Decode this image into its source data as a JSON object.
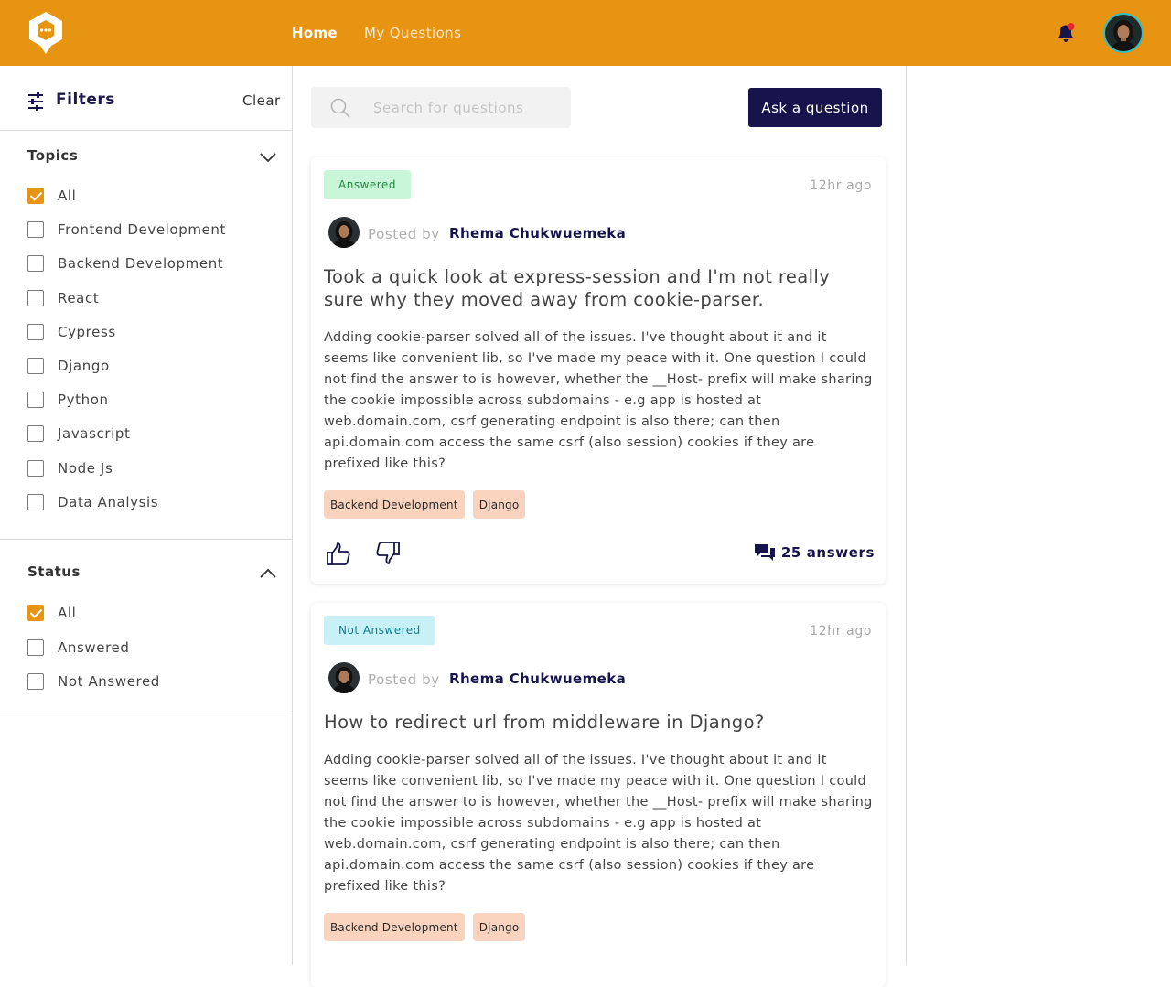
{
  "header": {
    "nav": {
      "home": "Home",
      "my_questions": "My Questions"
    },
    "accent": "#e89413"
  },
  "sidebar": {
    "filters_title": "Filters",
    "clear_label": "Clear",
    "topics": {
      "title": "Topics",
      "expanded": true,
      "options": [
        {
          "label": "All",
          "checked": true
        },
        {
          "label": "Frontend Development",
          "checked": false
        },
        {
          "label": "Backend Development",
          "checked": false
        },
        {
          "label": "React",
          "checked": false
        },
        {
          "label": "Cypress",
          "checked": false
        },
        {
          "label": "Django",
          "checked": false
        },
        {
          "label": "Python",
          "checked": false
        },
        {
          "label": "Javascript",
          "checked": false
        },
        {
          "label": "Node Js",
          "checked": false
        },
        {
          "label": "Data Analysis",
          "checked": false
        }
      ]
    },
    "status": {
      "title": "Status",
      "expanded": true,
      "options": [
        {
          "label": "All",
          "checked": true
        },
        {
          "label": "Answered",
          "checked": false
        },
        {
          "label": "Not Answered",
          "checked": false
        }
      ]
    }
  },
  "search": {
    "placeholder": "Search for questions",
    "value": ""
  },
  "ask_button": "Ask a question",
  "questions": [
    {
      "status": "Answered",
      "time": "12hr ago",
      "posted_by_label": "Posted by",
      "author": "Rhema Chukwuemeka",
      "title": "Took a quick look at express-session and I'm not really sure why they moved away from cookie-parser.",
      "body": "Adding cookie-parser solved all of the issues. I've thought about it and it seems like convenient lib, so I've made my peace with it. One question I could not find the answer to is however, whether the __Host- prefix will make sharing the cookie impossible across subdomains - e.g app is hosted at web.domain.com, csrf generating endpoint is also there; can then api.domain.com access the same csrf (also session) cookies if they are prefixed like this?",
      "tags": [
        "Backend Development",
        "Django"
      ],
      "answers": "25 answers"
    },
    {
      "status": "Not Answered",
      "time": "12hr ago",
      "posted_by_label": "Posted by",
      "author": "Rhema Chukwuemeka",
      "title": "How to redirect url from middleware in Django?",
      "body": "Adding cookie-parser solved all of the issues. I've thought about it and it seems like convenient lib, so I've made my peace with it. One question I could not find the answer to is however, whether the __Host- prefix will make sharing the cookie impossible across subdomains - e.g app is hosted at web.domain.com, csrf generating endpoint is also there; can then api.domain.com access the same csrf (also session) cookies if they are prefixed like this?",
      "tags": [
        "Backend Development",
        "Django"
      ]
    }
  ]
}
